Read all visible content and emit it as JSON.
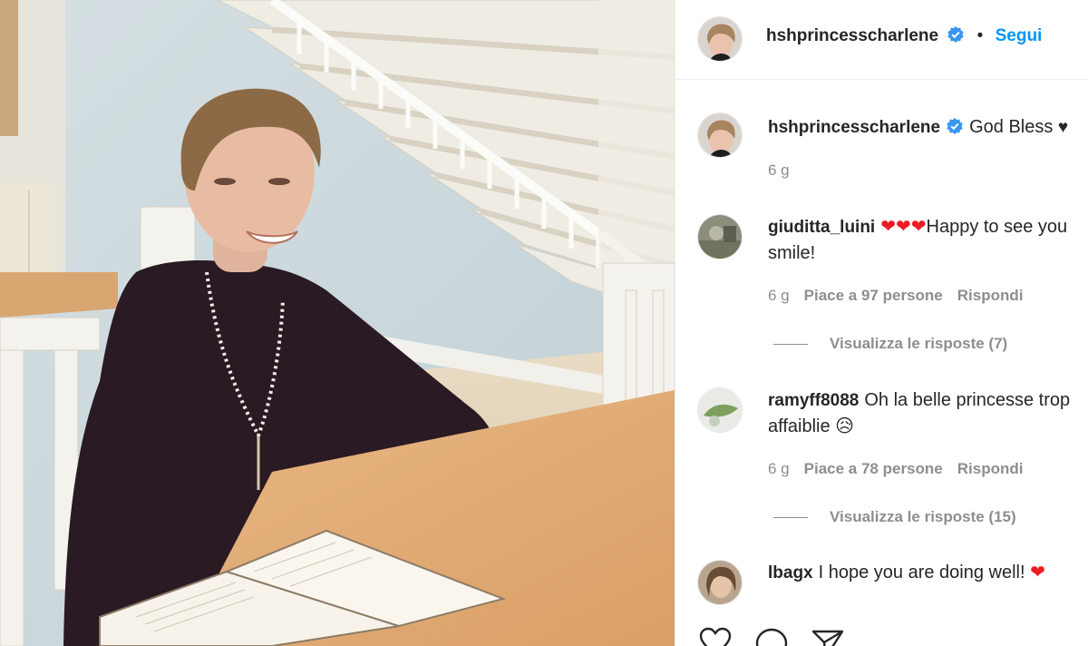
{
  "post": {
    "author": "hshprincesscharlene",
    "follow_label": "Segui",
    "separator": "•"
  },
  "caption": {
    "username": "hshprincesscharlene",
    "text": "God Bless",
    "emoji": "♥",
    "time": "6 g"
  },
  "comments": [
    {
      "username": "giuditta_luini",
      "text_prefix": "❤❤❤",
      "text": "Happy to see you smile!",
      "time": "6 g",
      "likes": "Piace a 97 persone",
      "reply": "Rispondi",
      "view_replies": "Visualizza le risposte (7)"
    },
    {
      "username": "ramyff8088",
      "text": "Oh la belle princesse trop affaiblie",
      "emoji": "😥",
      "time": "6 g",
      "likes": "Piace a 78 persone",
      "reply": "Rispondi",
      "view_replies": "Visualizza le risposte (15)"
    },
    {
      "username": "lbagx",
      "text": "I hope you are doing well!",
      "emoji": "❤"
    }
  ],
  "icons": {
    "verified": "verified-badge-icon",
    "like": "heart-outline-icon",
    "comment": "comment-bubble-icon",
    "share": "paper-plane-icon"
  },
  "colors": {
    "accent": "#0095f6",
    "verified": "#3897f0",
    "muted": "#8e8e8e",
    "text": "#262626",
    "heart": "#ed1c24"
  }
}
